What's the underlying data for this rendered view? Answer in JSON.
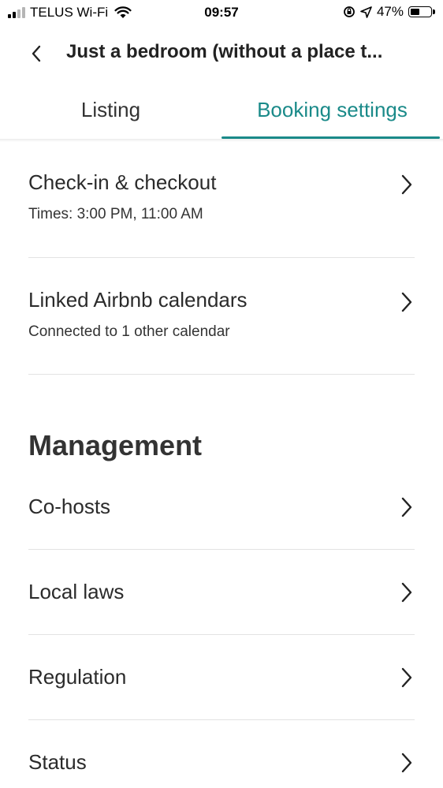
{
  "status_bar": {
    "carrier": "TELUS Wi-Fi",
    "time": "09:57",
    "battery_percent": "47%",
    "battery_level": 0.47
  },
  "header": {
    "title": "Just a bedroom (without a place t..."
  },
  "tabs": [
    {
      "label": "Listing",
      "selected": false
    },
    {
      "label": "Booking settings",
      "selected": true
    }
  ],
  "booking": {
    "checkin": {
      "title": "Check-in & checkout",
      "subtitle": "Times: 3:00 PM, 11:00 AM"
    },
    "linked_calendars": {
      "title": "Linked Airbnb calendars",
      "subtitle": "Connected to 1 other calendar"
    }
  },
  "management": {
    "heading": "Management",
    "items": [
      {
        "label": "Co-hosts"
      },
      {
        "label": "Local laws"
      },
      {
        "label": "Regulation"
      },
      {
        "label": "Status"
      }
    ]
  },
  "colors": {
    "accent": "#1a8a89",
    "text": "#222222",
    "divider": "#e3e3e3"
  }
}
